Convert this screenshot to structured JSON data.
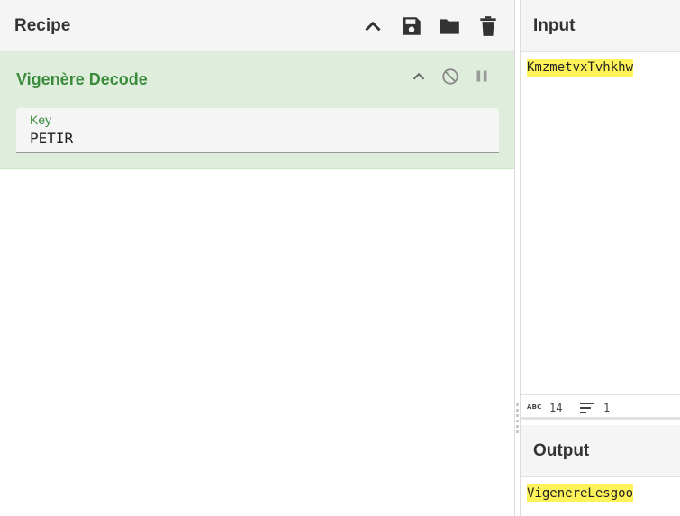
{
  "recipe": {
    "title": "Recipe",
    "icons": [
      "chevron-up-icon",
      "save-icon",
      "folder-icon",
      "trash-icon"
    ],
    "operation": {
      "name": "Vigenère Decode",
      "icons": [
        "chevron-up-icon",
        "disable-icon",
        "pause-icon"
      ],
      "arg_label": "Key",
      "arg_value": "PETIR"
    }
  },
  "input": {
    "title": "Input",
    "text": "KmzmetvxTvhkhw",
    "status": {
      "length_icon": "ABC",
      "length": "14",
      "lines": "1"
    }
  },
  "output": {
    "title": "Output",
    "text": "VigenereLesgoo"
  },
  "colors": {
    "op_background": "#dfeedc",
    "op_title": "#3b8b3d",
    "highlight": "#fff35a",
    "header_bg": "#f5f5f5"
  }
}
